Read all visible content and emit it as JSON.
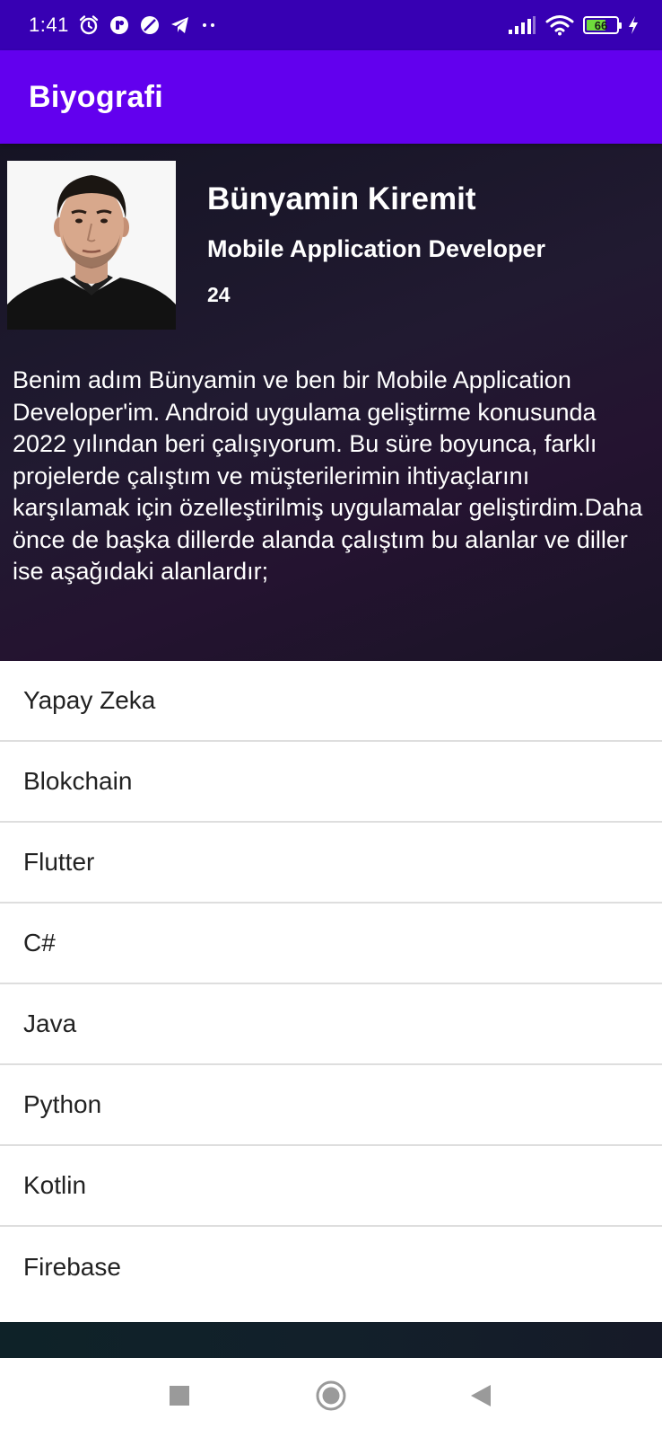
{
  "status_bar": {
    "time": "1:41",
    "battery_level": "66",
    "battery_fraction": 0.66,
    "icons": [
      "alarm-icon",
      "app-notification-icon",
      "blocked-icon",
      "telegram-icon",
      "more-dots-icon",
      "signal-icon",
      "wifi-icon",
      "battery-icon",
      "charging-icon"
    ],
    "battery_color": "#6fdc3c"
  },
  "app_bar": {
    "title": "Biyografi",
    "color": "#6200ee"
  },
  "profile": {
    "name": "Bünyamin Kiremit",
    "role": "Mobile Application Developer",
    "age": "24",
    "bio": "Benim adım Bünyamin ve ben bir Mobile Application Developer'im. Android uygulama geliştirme konusunda 2022 yılından beri çalışıyorum. Bu süre boyunca, farklı projelerde çalıştım ve müşterilerimin ihtiyaçlarını karşılamak için özelleştirilmiş uygulamalar geliştirdim.Daha önce de başka dillerde alanda çalıştım bu alanlar ve diller ise aşağıdaki alanlardır;"
  },
  "skills": [
    {
      "label": "Yapay Zeka"
    },
    {
      "label": "Blokchain"
    },
    {
      "label": "Flutter"
    },
    {
      "label": "C#"
    },
    {
      "label": "Java"
    },
    {
      "label": "Python"
    },
    {
      "label": "Kotlin"
    },
    {
      "label": "Firebase"
    }
  ],
  "nav_bar": {
    "icons": [
      "recents-square-icon",
      "home-circle-icon",
      "back-triangle-icon"
    ]
  }
}
